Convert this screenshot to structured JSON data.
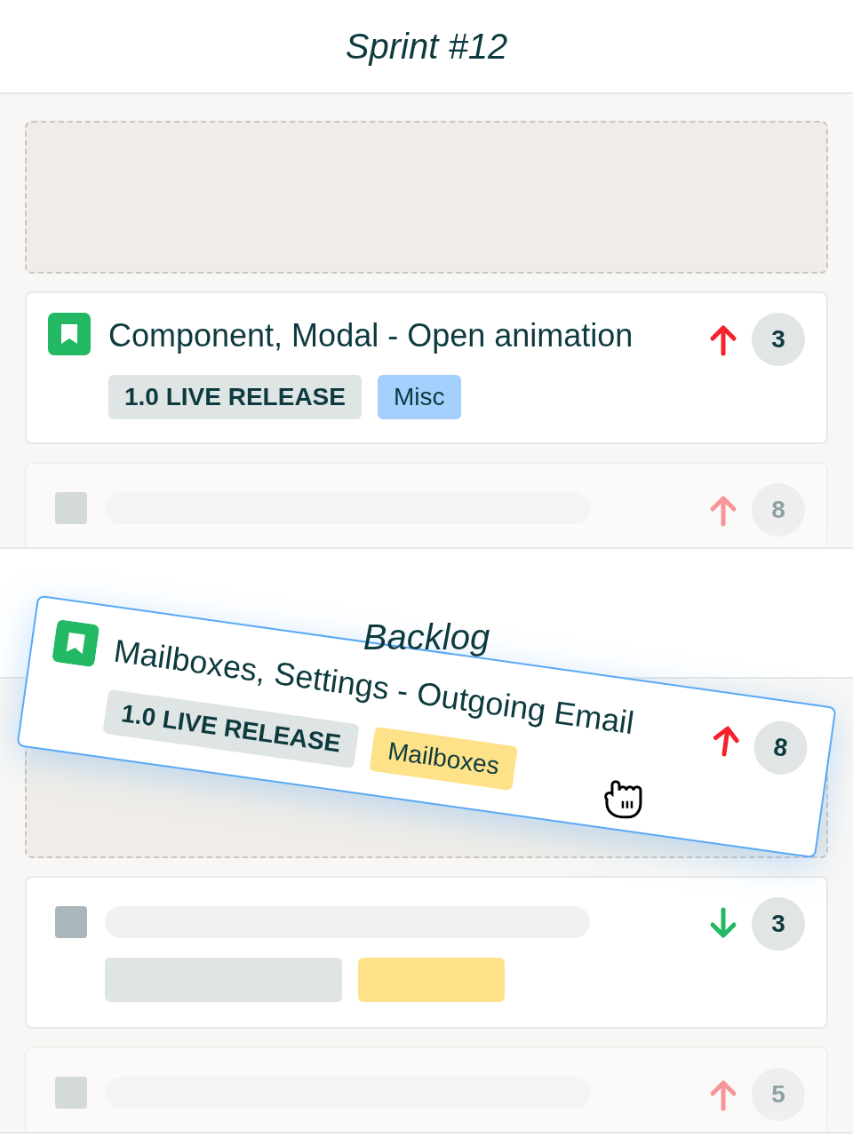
{
  "sections": [
    {
      "title": "Sprint #12",
      "items": [
        {
          "kind": "placeholder"
        },
        {
          "kind": "card",
          "faded": false,
          "title": "Component, Modal - Open animation",
          "tags": [
            {
              "label": "1.0 LIVE RELEASE",
              "color": "#dfe4e4"
            },
            {
              "label": "Misc",
              "color": "#a3d0fd"
            }
          ],
          "priority": {
            "kind": "up"
          },
          "points": "3"
        },
        {
          "kind": "skeleton",
          "faded": true,
          "priority": {
            "kind": "up"
          },
          "points": "8"
        }
      ]
    },
    {
      "title": "Backlog",
      "items": [
        {
          "kind": "placeholder"
        },
        {
          "kind": "skeleton",
          "faded": false,
          "tags": [
            {
              "color": "#dfe4e4"
            },
            {
              "color": "#fde28a"
            }
          ],
          "priority": {
            "kind": "down"
          },
          "points": "3"
        },
        {
          "kind": "skeleton",
          "faded": true,
          "priority": {
            "kind": "up"
          },
          "points": "5"
        }
      ]
    }
  ],
  "dragging": {
    "title": "Mailboxes, Settings - Outgoing Email",
    "tags": [
      {
        "label": "1.0 LIVE RELEASE",
        "color": "#dfe4e4"
      },
      {
        "label": "Mailboxes",
        "color": "#fde28a"
      }
    ],
    "priority": {
      "kind": "up"
    },
    "points": "8"
  }
}
